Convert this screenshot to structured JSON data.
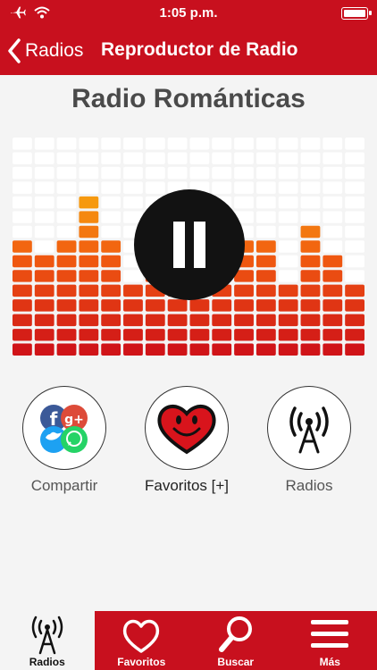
{
  "status_bar": {
    "time": "1:05 p.m."
  },
  "nav": {
    "back_label": "Radios",
    "title": "Reproductor de Radio"
  },
  "player": {
    "station_name": "Radio Románticas",
    "state": "playing"
  },
  "equalizer": {
    "levels": [
      8,
      7,
      8,
      11,
      8,
      5,
      7,
      9,
      9,
      7,
      8,
      8,
      5,
      9,
      7,
      5
    ],
    "max_level": 15,
    "colors": {
      "top": "#f7a20f",
      "mid": "#f15a10",
      "bottom": "#d01418",
      "empty": "#ffffff"
    }
  },
  "actions": {
    "share_label": "Compartir",
    "favorites_label": "Favoritos [+]",
    "radios_label": "Radios"
  },
  "tabs": [
    {
      "label": "Radios",
      "active": true
    },
    {
      "label": "Favoritos",
      "active": false
    },
    {
      "label": "Buscar",
      "active": false
    },
    {
      "label": "Más",
      "active": false
    }
  ],
  "colors": {
    "brand": "#c8101e",
    "background": "#f4f4f4"
  }
}
